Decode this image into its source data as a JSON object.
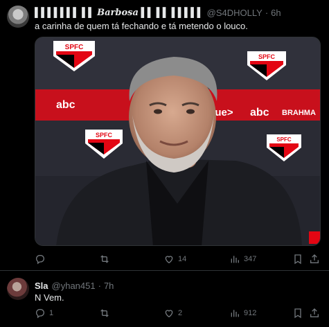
{
  "tweets": [
    {
      "author_name_glitch": "▌▌▌▌▌▌▌ ▌▌",
      "author_name_styled": "Barbosa",
      "author_name_glitch2": "▌▌ ▌▌ ▌▌▌▌▌",
      "handle": "@S4DHOLLY",
      "dot": "·",
      "time": "6h",
      "text": "a carinha de quem tá fechando e tá metendo o louco.",
      "media": {
        "logo_text": "SPFC",
        "sponsors": [
          "abc",
          "blue>",
          "abc",
          "BRAHMA"
        ]
      },
      "stats": {
        "replies": "",
        "retweets": "",
        "likes": "14",
        "views": "347"
      }
    },
    {
      "author_name": "Sla",
      "handle": "@yhan451",
      "dot": "·",
      "time": "7h",
      "text": "N Vem.",
      "stats": {
        "replies": "1",
        "retweets": "",
        "likes": "2",
        "views": "912"
      }
    }
  ],
  "colors": {
    "background": "#000000",
    "text": "#e7e9ea",
    "muted": "#71767b",
    "divider": "#2f3336",
    "spfc_red": "#e30613"
  },
  "icons": [
    "reply-icon",
    "retweet-icon",
    "like-icon",
    "views-icon",
    "bookmark-icon",
    "share-icon"
  ]
}
